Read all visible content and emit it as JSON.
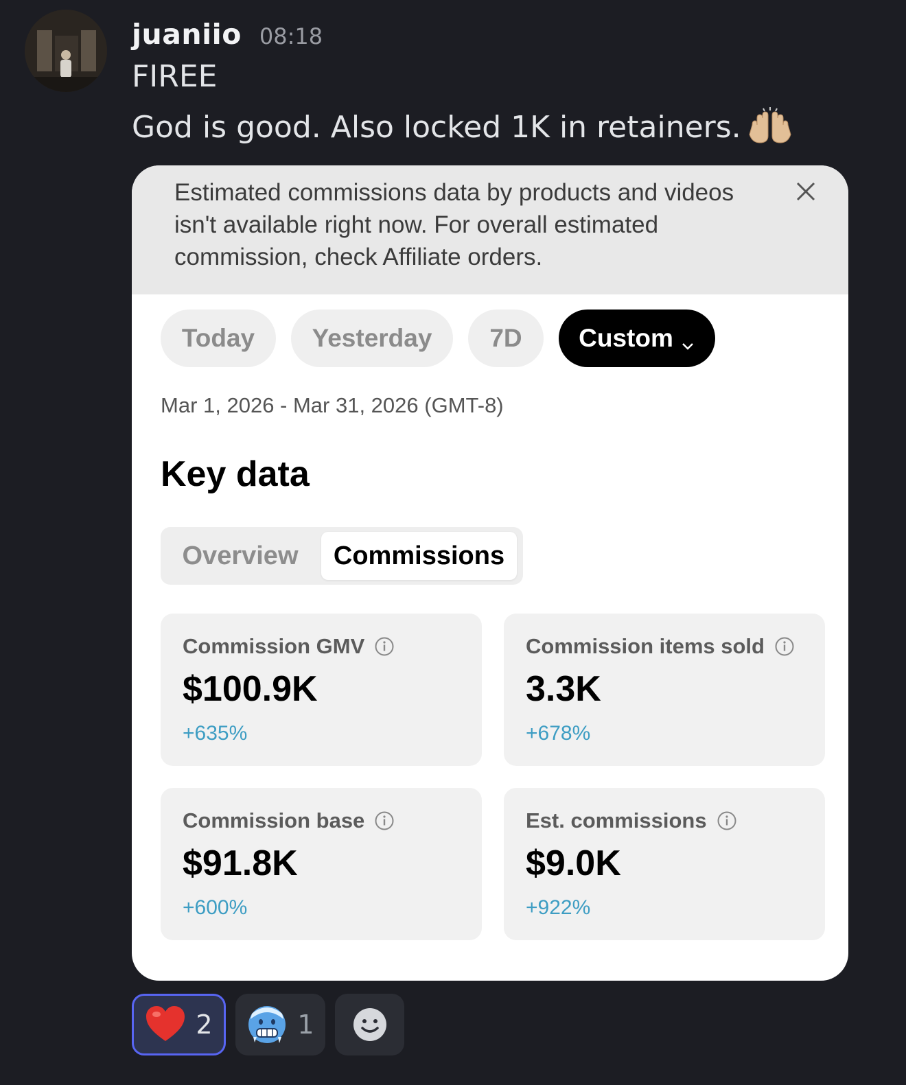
{
  "message": {
    "username": "juaniio",
    "timestamp": "08:18",
    "line1": "FIREE",
    "line2": "God is good.  Also locked 1K in retainers.",
    "line2_emoji": "raising-hands-emoji"
  },
  "card": {
    "notice": "Estimated commissions data by products and videos isn't available right now. For overall estimated commission, check Affiliate orders.",
    "filters": {
      "today": "Today",
      "yesterday": "Yesterday",
      "seven_days": "7D",
      "custom": "Custom",
      "selected": "Custom"
    },
    "date_range": "Mar 1, 2026 - Mar 31, 2026 (GMT-8)",
    "section_title": "Key data",
    "tabs": {
      "overview": "Overview",
      "commissions": "Commissions",
      "selected": "Commissions"
    },
    "metrics": [
      {
        "label": "Commission GMV",
        "value": "$100.9K",
        "change": "+635%"
      },
      {
        "label": "Commission items sold",
        "value": "3.3K",
        "change": "+678%"
      },
      {
        "label": "Commission base",
        "value": "$91.8K",
        "change": "+600%"
      },
      {
        "label": "Est. commissions",
        "value": "$9.0K",
        "change": "+922%"
      }
    ]
  },
  "reactions": [
    {
      "icon": "red-heart-emoji",
      "count": "2",
      "active": true
    },
    {
      "icon": "cold-face-emoji",
      "count": "1",
      "active": false
    },
    {
      "icon": "add-reaction-icon",
      "count": ""
    }
  ],
  "colors": {
    "background": "#1c1d23",
    "accent_blue": "#5865f2",
    "change_positive": "#3d9dc3",
    "custom_chip": "#000000"
  }
}
